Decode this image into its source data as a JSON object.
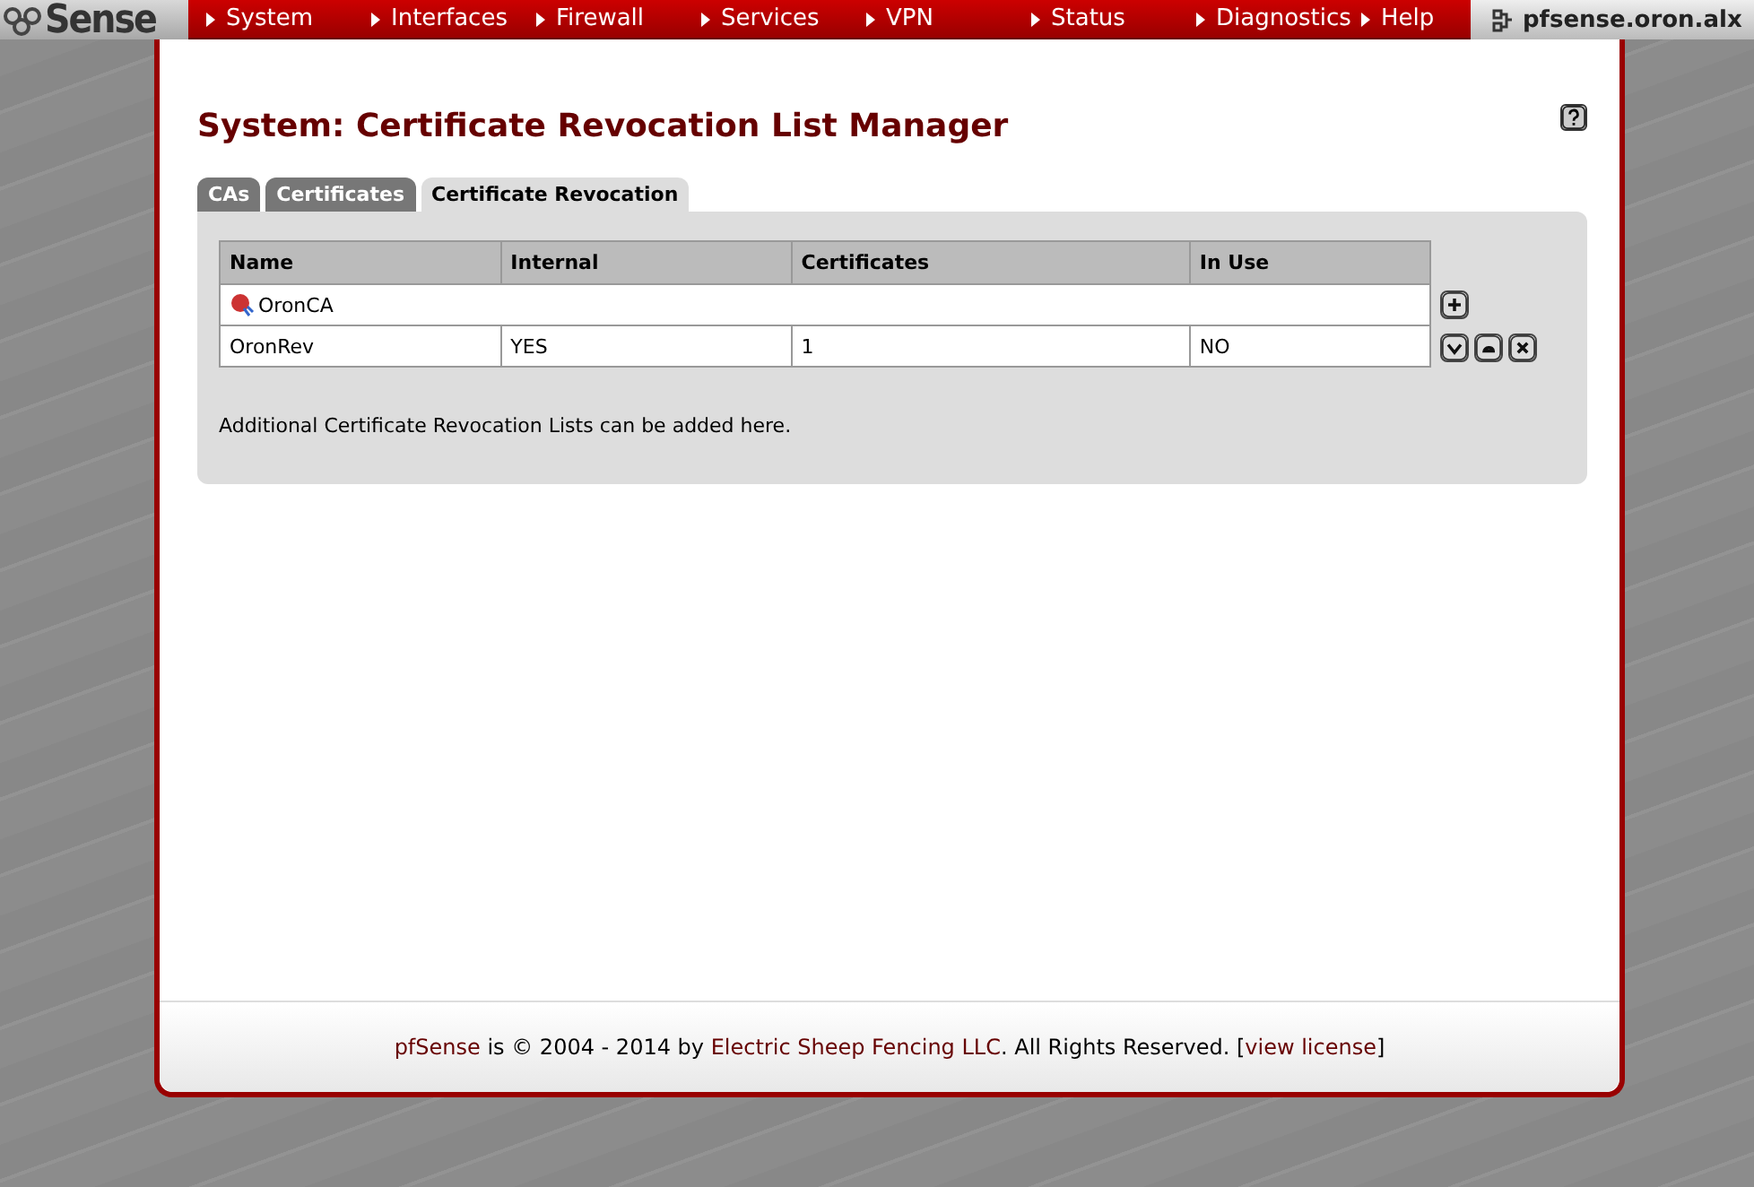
{
  "logo": {
    "text": "Sense"
  },
  "nav": [
    {
      "label": "System"
    },
    {
      "label": "Interfaces"
    },
    {
      "label": "Firewall"
    },
    {
      "label": "Services"
    },
    {
      "label": "VPN"
    },
    {
      "label": "Status"
    },
    {
      "label": "Diagnostics"
    },
    {
      "label": "Help"
    }
  ],
  "hostname": "pfsense.oron.alx",
  "title": "System: Certificate Revocation List Manager",
  "tabs": [
    {
      "label": "CAs",
      "selected": false
    },
    {
      "label": "Certificates",
      "selected": false
    },
    {
      "label": "Certificate Revocation",
      "selected": true
    }
  ],
  "table": {
    "columns": [
      "Name",
      "Internal",
      "Certificates",
      "In Use"
    ],
    "rows": [
      {
        "kind": "ca",
        "name": "OronCA"
      },
      {
        "kind": "crl",
        "name": "OronRev",
        "internal": "YES",
        "certificates": "1",
        "in_use": "NO"
      }
    ]
  },
  "note": "Additional Certificate Revocation Lists can be added here.",
  "footer": [
    {
      "kind": "link",
      "text": "pfSense"
    },
    {
      "kind": "text",
      "text": " is © 2004 - 2014 by "
    },
    {
      "kind": "link",
      "text": "Electric Sheep Fencing LLC"
    },
    {
      "kind": "text",
      "text": ". All Rights Reserved. ["
    },
    {
      "kind": "link",
      "text": "view license"
    },
    {
      "kind": "text",
      "text": "]"
    }
  ]
}
